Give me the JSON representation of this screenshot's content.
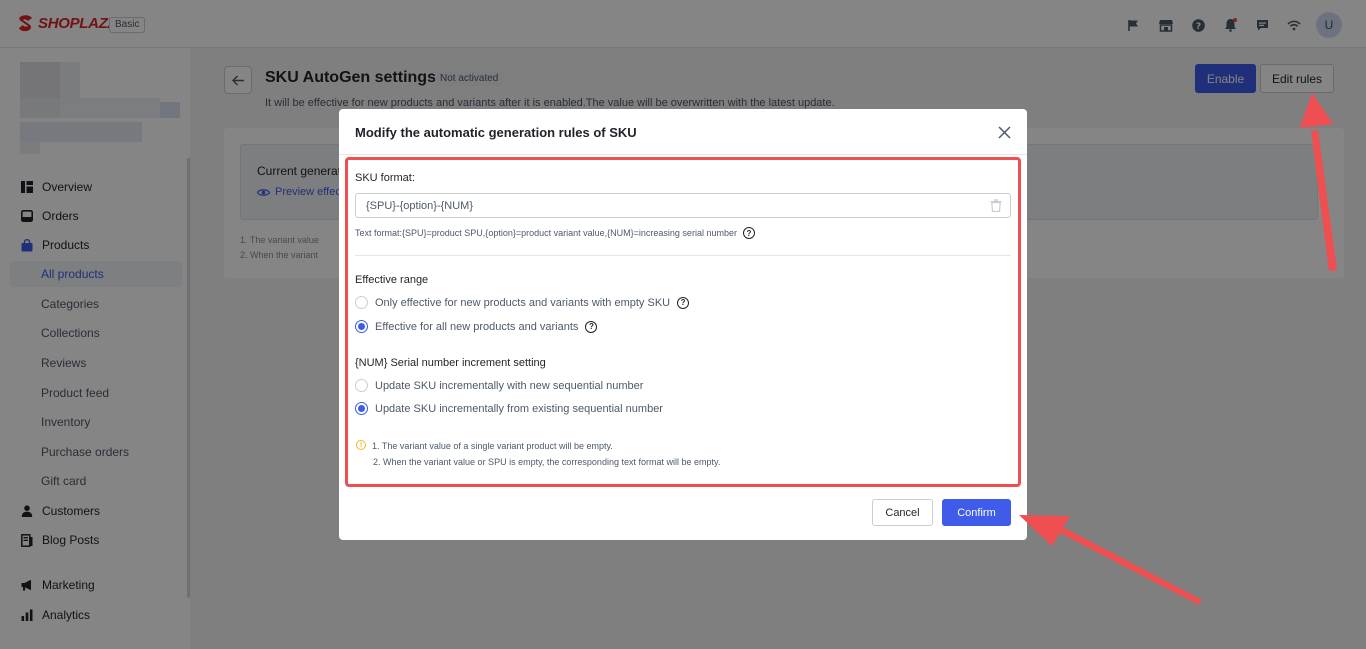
{
  "brand": {
    "name": "SHOPLAZZA",
    "plan": "Basic",
    "avatar_letter": "U"
  },
  "top_icons": [
    "flag-icon",
    "store-icon",
    "help-icon",
    "bell-icon",
    "chat-icon",
    "wifi-icon"
  ],
  "nav": {
    "items": [
      {
        "label": "Overview",
        "icon": "overview-icon"
      },
      {
        "label": "Orders",
        "icon": "orders-icon"
      },
      {
        "label": "Products",
        "icon": "products-icon"
      },
      {
        "label": "All products"
      },
      {
        "label": "Categories"
      },
      {
        "label": "Collections"
      },
      {
        "label": "Reviews"
      },
      {
        "label": "Product feed"
      },
      {
        "label": "Inventory"
      },
      {
        "label": "Purchase orders"
      },
      {
        "label": "Gift card"
      },
      {
        "label": "Customers",
        "icon": "customers-icon"
      },
      {
        "label": "Blog Posts",
        "icon": "blog-icon"
      },
      {
        "label": "Marketing",
        "icon": "marketing-icon"
      },
      {
        "label": "Analytics",
        "icon": "analytics-icon"
      }
    ]
  },
  "page": {
    "title": "SKU AutoGen settings",
    "status": "Not activated",
    "description": "It will be effective for new products and variants after it is enabled.The value will be overwritten with the latest update.",
    "enable_label": "Enable",
    "edit_rules_label": "Edit rules",
    "current_label": "Current generati",
    "preview_label": "Preview effec",
    "note1": "1. The variant value",
    "note2": "2. When the variant"
  },
  "modal": {
    "title": "Modify the automatic generation rules of SKU",
    "sku_format_label": "SKU format:",
    "sku_format_value": "{SPU}-{option}-{NUM}",
    "text_format_hint": "Text format:{SPU}=product SPU,{option}=product variant value,{NUM}=increasing serial number",
    "effective_range_label": "Effective range",
    "range_options": [
      {
        "label": "Only effective for new products and variants with empty SKU",
        "selected": false
      },
      {
        "label": "Effective for all new products and variants",
        "selected": true
      }
    ],
    "serial_label": "{NUM} Serial number increment setting",
    "serial_options": [
      {
        "label": "Update SKU incrementally with new sequential number",
        "selected": false
      },
      {
        "label": "Update SKU incrementally from existing sequential number",
        "selected": true
      }
    ],
    "notes": [
      "1. The variant value of a single variant product will be empty.",
      "2. When the variant value or SPU is empty, the corresponding text format will be empty."
    ],
    "cancel_label": "Cancel",
    "confirm_label": "Confirm"
  },
  "colors": {
    "accent": "#3f5be9",
    "annotation": "#ef4f51",
    "brand": "#d9252a",
    "warning": "#f5b820"
  }
}
